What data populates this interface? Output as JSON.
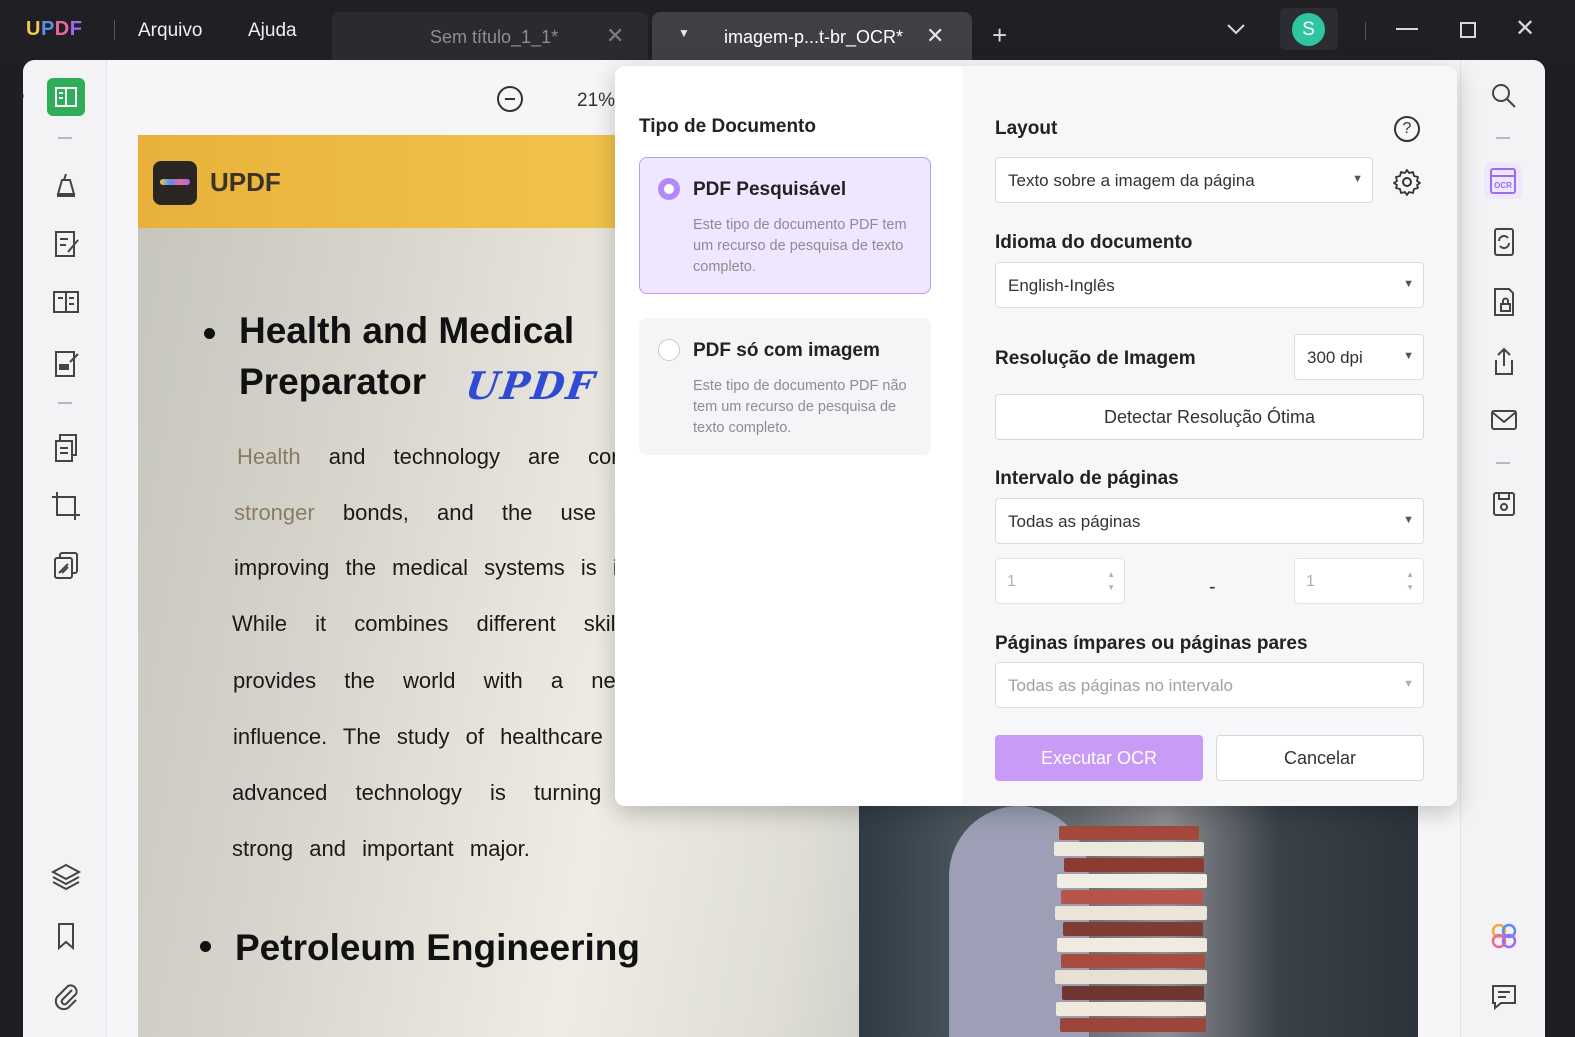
{
  "app": {
    "logo": "UPDF",
    "menu": [
      "Arquivo",
      "Ajuda"
    ],
    "tabs": [
      {
        "title": "Sem título_1_1*",
        "active": false
      },
      {
        "title": "imagem-p...t-br_OCR*",
        "active": true
      }
    ],
    "user_initial": "S"
  },
  "toolbar": {
    "zoom": "21%"
  },
  "document": {
    "banner_text": "UPDF",
    "heading1_line1": "Health and Medical",
    "heading1_line2": "Preparator",
    "signature": "UPDF",
    "paragraph_lines": [
      {
        "faded": "Health",
        "text": "and   technology   are   con"
      },
      {
        "faded": "stronger",
        "text": "bonds,  and  the  use  of"
      },
      {
        "faded": "",
        "text": "improving the medical systems is in ac"
      },
      {
        "faded": "",
        "text": "While  it  combines  different  skills"
      },
      {
        "faded": "",
        "text": "provides  the  world  with  a  new"
      },
      {
        "faded": "",
        "text": "influence. The study of healthcare unc"
      },
      {
        "faded": "",
        "text": "advanced  technology  is  turning  o"
      },
      {
        "faded": "",
        "text": "strong and important major."
      }
    ],
    "heading2": "Petroleum Engineering"
  },
  "ocr_dialog": {
    "doc_type_title": "Tipo de Documento",
    "options": [
      {
        "title": "PDF Pesquisável",
        "desc": "Este tipo de documento PDF tem um recurso de pesquisa de texto completo.",
        "selected": true
      },
      {
        "title": "PDF só com imagem",
        "desc": "Este tipo de documento PDF não tem um recurso de pesquisa de texto completo.",
        "selected": false
      }
    ],
    "layout_label": "Layout",
    "layout_value": "Texto sobre a imagem da página",
    "language_label": "Idioma do documento",
    "language_value": "English-Inglês",
    "resolution_label": "Resolução de Imagem",
    "resolution_value": "300 dpi",
    "detect_button": "Detectar Resolução Ótima",
    "page_range_label": "Intervalo de páginas",
    "page_range_value": "Todas as páginas",
    "range_from": "1",
    "range_to": "1",
    "range_separator": "-",
    "odd_even_label": "Páginas ímpares ou páginas pares",
    "odd_even_value": "Todas as páginas no intervalo",
    "run_button": "Executar OCR",
    "cancel_button": "Cancelar"
  },
  "colors": {
    "accent": "#b38af5",
    "primary_button": "#c79bf6",
    "selected_card_bg": "#efe6ff",
    "titlebar": "#202024",
    "avatar": "#2fc5a2",
    "reader_active": "#2fae5a"
  }
}
